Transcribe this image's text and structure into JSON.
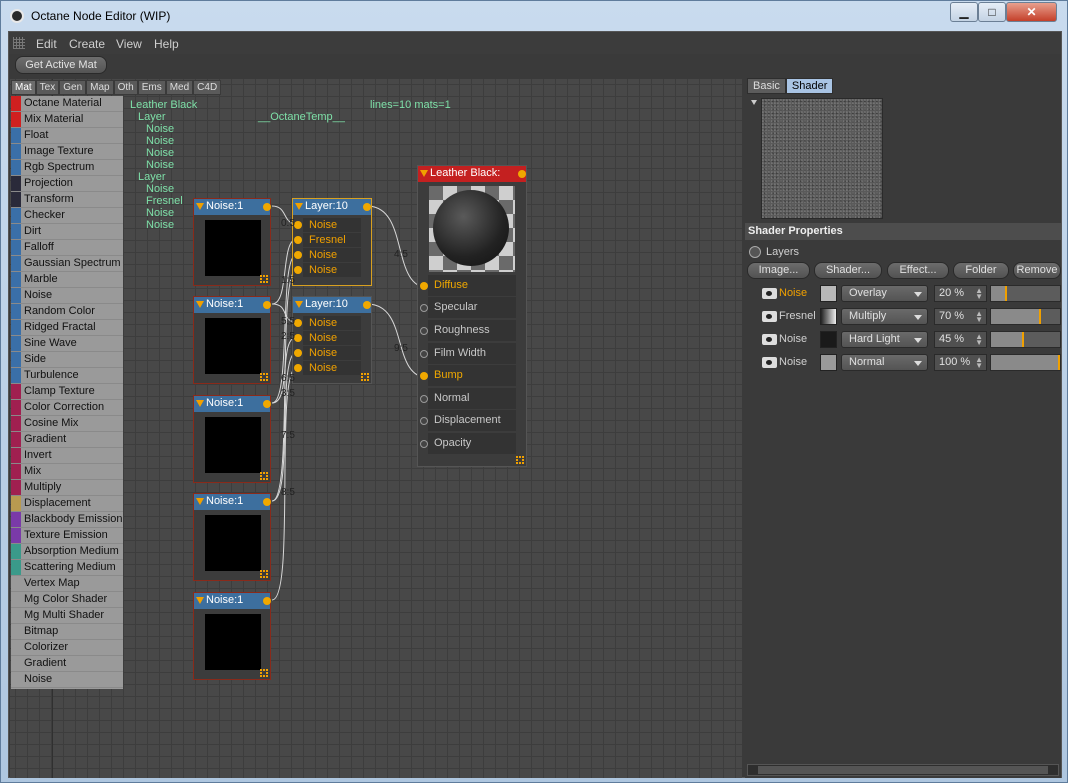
{
  "window": {
    "title": "Octane Node Editor (WIP)",
    "minimize": "▁",
    "maximize": "□",
    "close": "✕"
  },
  "menu": {
    "items": [
      "Edit",
      "Create",
      "View",
      "Help"
    ]
  },
  "toolbar": {
    "get_active_mat": "Get Active Mat"
  },
  "category_tabs": [
    "Mat",
    "Tex",
    "Gen",
    "Map",
    "Oth",
    "Ems",
    "Med",
    "C4D"
  ],
  "node_list": [
    {
      "label": "Octane Material",
      "color": "#d02020"
    },
    {
      "label": "Mix Material",
      "color": "#d02020"
    },
    {
      "label": "Float",
      "color": "#3a6fa8"
    },
    {
      "label": "Image Texture",
      "color": "#3a6fa8"
    },
    {
      "label": "Rgb Spectrum",
      "color": "#3a6fa8"
    },
    {
      "label": "Projection",
      "color": "#2a2a3a"
    },
    {
      "label": "Transform",
      "color": "#2a2a3a"
    },
    {
      "label": "Checker",
      "color": "#3a6fa8"
    },
    {
      "label": "Dirt",
      "color": "#3a6fa8"
    },
    {
      "label": "Falloff",
      "color": "#3a6fa8"
    },
    {
      "label": "Gaussian Spectrum",
      "color": "#3a6fa8"
    },
    {
      "label": "Marble",
      "color": "#3a6fa8"
    },
    {
      "label": "Noise",
      "color": "#3a6fa8"
    },
    {
      "label": "Random Color",
      "color": "#3a6fa8"
    },
    {
      "label": "Ridged Fractal",
      "color": "#3a6fa8"
    },
    {
      "label": "Sine Wave",
      "color": "#3a6fa8"
    },
    {
      "label": "Side",
      "color": "#3a6fa8"
    },
    {
      "label": "Turbulence",
      "color": "#3a6fa8"
    },
    {
      "label": "Clamp Texture",
      "color": "#a02050"
    },
    {
      "label": "Color Correction",
      "color": "#a02050"
    },
    {
      "label": "Cosine Mix",
      "color": "#a02050"
    },
    {
      "label": "Gradient",
      "color": "#a02050"
    },
    {
      "label": "Invert",
      "color": "#a02050"
    },
    {
      "label": "Mix",
      "color": "#a02050"
    },
    {
      "label": "Multiply",
      "color": "#a02050"
    },
    {
      "label": "Displacement",
      "color": "#b89a50"
    },
    {
      "label": "Blackbody Emission",
      "color": "#7a3aa8"
    },
    {
      "label": "Texture Emission",
      "color": "#7a3aa8"
    },
    {
      "label": "Absorption Medium",
      "color": "#3a9a8a"
    },
    {
      "label": "Scattering Medium",
      "color": "#3a9a8a"
    },
    {
      "label": "Vertex Map",
      "color": "#9a9a9a"
    },
    {
      "label": "Mg Color Shader",
      "color": "#9a9a9a"
    },
    {
      "label": "Mg Multi Shader",
      "color": "#9a9a9a"
    },
    {
      "label": "Bitmap",
      "color": "#9a9a9a"
    },
    {
      "label": "Colorizer",
      "color": "#9a9a9a"
    },
    {
      "label": "Gradient",
      "color": "#9a9a9a"
    },
    {
      "label": "Noise",
      "color": "#9a9a9a"
    }
  ],
  "tree": {
    "items": [
      "Leather Black",
      "Layer",
      "Noise",
      "Noise",
      "Noise",
      "Noise",
      "Layer",
      "Noise",
      "Fresnel",
      "Noise",
      "Noise"
    ],
    "temp_label": "__OctaneTemp__",
    "stats": "lines=10 mats=1"
  },
  "nodes": {
    "noise_title": "Noise:1",
    "layer_title": "Layer:10",
    "layer1_pins": [
      "Noise",
      "Fresnel",
      "Noise",
      "Noise"
    ],
    "layer2_pins": [
      "Noise",
      "Noise",
      "Noise",
      "Noise"
    ],
    "material_title": "Leather Black:",
    "material_pins": [
      "Diffuse",
      "Specular",
      "Roughness",
      "Film Width",
      "Bump",
      "Normal",
      "Displacement",
      "Opacity"
    ]
  },
  "edge_labels": [
    "0:5",
    "1:5",
    "5:5",
    "2:5",
    "6:5",
    "3:5",
    "7:5",
    "8:5",
    "4:5",
    "9:5"
  ],
  "right_panel": {
    "tabs": [
      "Basic",
      "Shader"
    ],
    "active_tab": "Shader",
    "section_title": "Shader Properties",
    "layers_label": "Layers",
    "buttons": [
      "Image...",
      "Shader...",
      "Effect...",
      "Folder",
      "Remove"
    ],
    "shader_rows": [
      {
        "name": "Noise",
        "blend": "Overlay",
        "percent": "20 %",
        "value": 0.2,
        "selected": true
      },
      {
        "name": "Fresnel",
        "blend": "Multiply",
        "percent": "70 %",
        "value": 0.7,
        "selected": false
      },
      {
        "name": "Noise",
        "blend": "Hard Light",
        "percent": "45 %",
        "value": 0.45,
        "selected": false
      },
      {
        "name": "Noise",
        "blend": "Normal",
        "percent": "100 %",
        "value": 1.0,
        "selected": false
      }
    ]
  },
  "colors": {
    "accent": "#f0a000",
    "node_header": "#3d6f9e",
    "material_header": "#c42020",
    "tree_text": "#7ee0a8",
    "active_tab": "#a9c4e4"
  }
}
